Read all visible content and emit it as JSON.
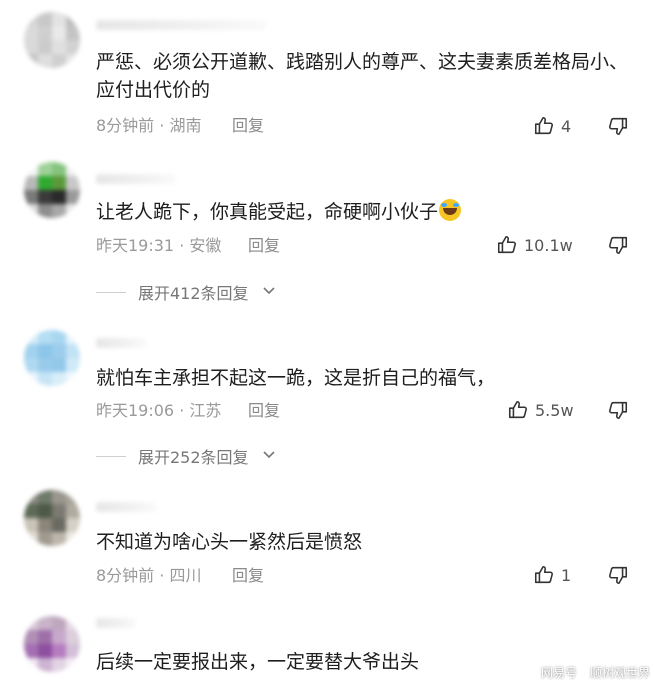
{
  "comments": [
    {
      "text": "严惩、必须公开道歉、践踏别人的尊严、这夫妻素质差格局小、应付出代价的",
      "meta": "8分钟前 · 湖南",
      "reply_label": "回复",
      "likes": "4",
      "avatar_colors": [
        "#d4d4d4",
        "#c8c8c8",
        "#e3e3e3",
        "#bdbdbd",
        "#dadada",
        "#cfcfcf",
        "#e9e9e9",
        "#c4c4c4",
        "#d9d9d9",
        "#cccccc",
        "#e0e0e0",
        "#d2d2d2",
        "#c6c6c6",
        "#dedede",
        "#d0d0d0",
        "#e6e6e6"
      ]
    },
    {
      "text": "让老人跪下，你真能受起，命硬啊小伙子",
      "emoji_icon": "rolling-laughing-emoji",
      "meta": "昨天19:31 · 安徽",
      "reply_label": "回复",
      "likes": "10.1w",
      "expand_label": "展开412条回复",
      "avatar_colors": [
        "#f5f5f5",
        "#9fd19a",
        "#86c47f",
        "#f0f0f0",
        "#b9b9b9",
        "#2faa2f",
        "#5a9a3c",
        "#c9c9c9",
        "#7a7a7a",
        "#3b3b3b",
        "#2a2a2a",
        "#9a9a9a",
        "#dcdcdc",
        "#8d8d8d",
        "#a8a8a8",
        "#e9e9e9"
      ]
    },
    {
      "text": "就怕车主承担不起这一跪，这是折自己的福气，",
      "meta": "昨天19:06 · 江苏",
      "reply_label": "回复",
      "likes": "5.5w",
      "expand_label": "展开252条回复",
      "avatar_colors": [
        "#d6ecf8",
        "#b5ddf3",
        "#a9d6f0",
        "#e6f3fb",
        "#a2d2ee",
        "#8cc6ea",
        "#9ccdec",
        "#c2e2f5",
        "#b0d9f1",
        "#99cbeb",
        "#93c8ea",
        "#d0eaf8",
        "#e8f4fb",
        "#c6e4f6",
        "#d9eef9",
        "#f0f8fc"
      ]
    },
    {
      "text": "不知道为啥心头一紧然后是愤怒",
      "meta": "8分钟前 · 四川",
      "reply_label": "回复",
      "likes": "1",
      "avatar_colors": [
        "#8c8a84",
        "#6f7a6a",
        "#9b978f",
        "#a6a299",
        "#5e6b57",
        "#4d5a47",
        "#7c7a72",
        "#b0ab9f",
        "#c9c4b8",
        "#8b867b",
        "#6a6a62",
        "#d5d0c5",
        "#e0dcd3",
        "#a09b90",
        "#bcb7ab",
        "#ece9e2"
      ]
    },
    {
      "text": "后续一定要报出来，一定要替大爷出头",
      "avatar_colors": [
        "#d8c8d8",
        "#c9b3c9",
        "#bfa7bf",
        "#e6dae6",
        "#b08fb5",
        "#9e6fa8",
        "#c7a9cc",
        "#dccfdc",
        "#a56fb3",
        "#8e4fa0",
        "#b67cc0",
        "#d4c0d8",
        "#efe6ef",
        "#cdb4d2",
        "#e2d4e4",
        "#f3ecf3"
      ]
    }
  ],
  "watermark": {
    "brand": "网易号",
    "account": "顺树观世界"
  }
}
